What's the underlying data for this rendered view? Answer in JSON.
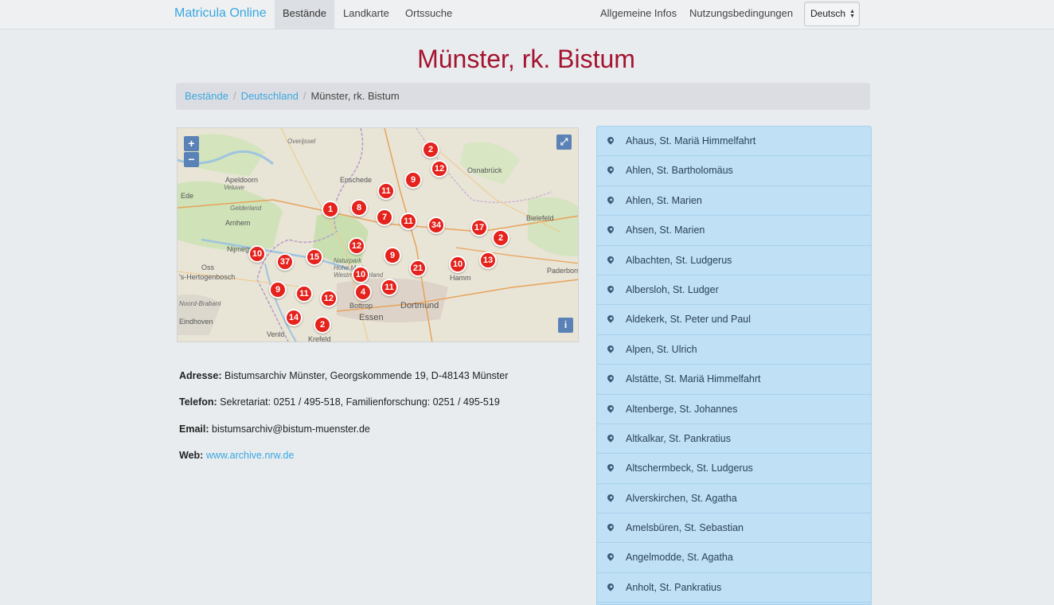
{
  "navbar": {
    "brand": "Matricula Online",
    "items": [
      "Bestände",
      "Landkarte",
      "Ortssuche"
    ],
    "right_items": [
      "Allgemeine Infos",
      "Nutzungsbedingungen"
    ],
    "language": "Deutsch"
  },
  "page_title": "Münster, rk. Bistum",
  "breadcrumb": {
    "items": [
      "Bestände",
      "Deutschland"
    ],
    "current": "Münster, rk. Bistum"
  },
  "map": {
    "zoom_in": "+",
    "zoom_out": "−",
    "fullscreen_icon": "expand-icon",
    "info_label": "i",
    "place_labels": [
      "Overijssel",
      "Apeldoorn",
      "Veluwe",
      "Enschede",
      "Osnabrück",
      "Gelderland",
      "Arnhem",
      "Bielefeld",
      "Nijmegen",
      "Naturpark Hohe Mark Westmünsterland",
      "Hamm",
      "Paderborn",
      "Dortmund",
      "Bottrop",
      "Essen",
      "Eindhoven",
      "Venlo",
      "Krefeld",
      "Noord-Brabant",
      "Ede",
      "Oss",
      "'s-Hertogenbosch"
    ],
    "markers": [
      "2",
      "12",
      "9",
      "11",
      "8",
      "1",
      "7",
      "11",
      "34",
      "17",
      "2",
      "12",
      "9",
      "10",
      "37",
      "15",
      "10",
      "21",
      "10",
      "13",
      "9",
      "11",
      "12",
      "4",
      "11",
      "14",
      "2"
    ]
  },
  "contact": {
    "address_label": "Adresse:",
    "address": "Bistumsarchiv Münster, Georgskommende 19, D-48143 Münster",
    "phone_label": "Telefon:",
    "phone": "Sekretariat: 0251 / 495-518, Familienforschung: 0251 / 495-519",
    "email_label": "Email:",
    "email": "bistumsarchiv@bistum-muenster.de",
    "web_label": "Web:",
    "web": "www.archive.nrw.de"
  },
  "parishes": [
    "Ahaus, St. Mariä Himmelfahrt",
    "Ahlen, St. Bartholomäus",
    "Ahlen, St. Marien",
    "Ahsen, St. Marien",
    "Albachten, St. Ludgerus",
    "Albersloh, St. Ludger",
    "Aldekerk, St. Peter und Paul",
    "Alpen, St. Ulrich",
    "Alstätte, St. Mariä Himmelfahrt",
    "Altenberge, St. Johannes",
    "Altkalkar, St. Pankratius",
    "Altschermbeck, St. Ludgerus",
    "Alverskirchen, St. Agatha",
    "Amelsbüren, St. Sebastian",
    "Angelmodde, St. Agatha",
    "Anholt, St. Pankratius"
  ],
  "colors": {
    "brand": "#3aa7e0",
    "title": "#a4132f",
    "marker": "#e5221c",
    "list_bg": "#bfe0f5"
  }
}
